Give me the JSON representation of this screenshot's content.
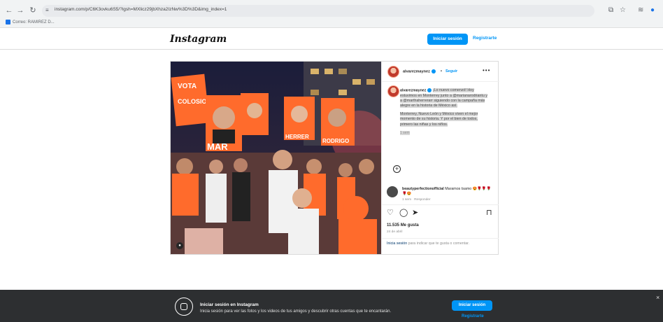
{
  "browser": {
    "url": "instagram.com/p/C6K3ovku6S5/?igsh=MXlicz29jbXhza2IzNw%3D%3D&img_index=1",
    "bookmark": "Correo: RAMIREZ D...",
    "icons": [
      "back-icon",
      "forward-icon",
      "reload-icon",
      "tune-icon",
      "install-icon",
      "star-icon",
      "extensions-icon",
      "profile-icon"
    ]
  },
  "header": {
    "logo": "Instagram",
    "login_button": "Iniciar sesión",
    "register_link": "Registrarte"
  },
  "post": {
    "author": "alvarezmaynez",
    "follow": "Seguir",
    "separator": "•",
    "more": "•••",
    "caption_p1": "¡Lo nuevo comenzó! Hoy estuvimos en Monterrey junto a @marianarodriantu y a @marthaherrerarr siguiendo con la campaña más alegre en la historia de México así.",
    "caption_p2": "Monterrey, Nuevo León y México viven el mejor momento de su historia. Y por el bien de todos, primero las niñas y los niños.",
    "caption_time": "1 sem",
    "comment_user": "beautyperfectionofficial",
    "comment_text": "Maramos tsamo",
    "comment_emojis": "😍🌹🌹🌹🌹😍",
    "comment_time": "1 sem",
    "comment_reply": "Responder",
    "likes": "11.535 Me gusta",
    "date": "24 de abril",
    "login_hint_link": "Inicia sesión",
    "login_hint_rest": " para indicar que te gusta o comentar."
  },
  "banner": {
    "title": "Iniciar sesión en Instagram",
    "subtitle": "Inicia sesión para ver las fotos y los videos de tus amigos y descubrir otras cuentas que te encantarán.",
    "login_button": "Iniciar sesión",
    "register_link": "Registrarte",
    "close": "×"
  },
  "photo_signs": {
    "sign1": "VOTA",
    "sign2": "COLOSIO",
    "sign3": "MAR",
    "sign4": "HERRER",
    "sign5": "RODRIGO"
  },
  "colors": {
    "accent": "#0095f6",
    "banner_bg": "#2d2f31",
    "campaign_orange": "#ff6b2c"
  }
}
